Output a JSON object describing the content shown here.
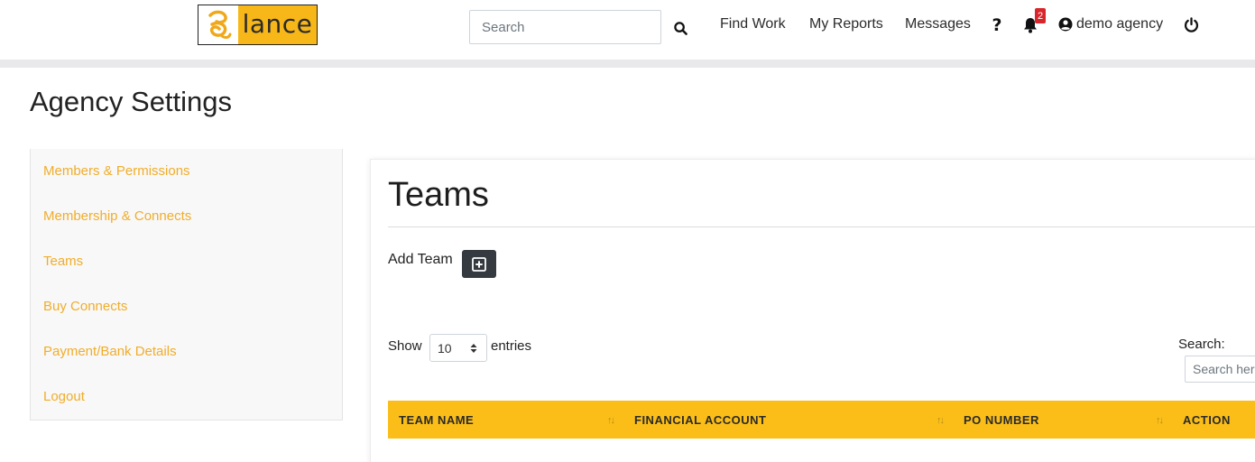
{
  "header": {
    "logo_text": "lance",
    "search": {
      "placeholder": "Search"
    },
    "nav": {
      "find_work": "Find Work",
      "my_reports": "My Reports",
      "messages": "Messages"
    },
    "help_glyph": "?",
    "notifications_count": "2",
    "user_name": "demo agency",
    "icons": [
      "search-icon",
      "question-icon",
      "bell-icon",
      "user-circle-icon",
      "power-icon"
    ]
  },
  "page": {
    "title": "Agency Settings"
  },
  "sidebar": {
    "items": [
      {
        "label": "Members & Permissions"
      },
      {
        "label": "Membership & Connects"
      },
      {
        "label": "Teams"
      },
      {
        "label": "Buy Connects"
      },
      {
        "label": "Payment/Bank Details"
      },
      {
        "label": "Logout"
      }
    ]
  },
  "main": {
    "title": "Teams",
    "add_team_label": "Add Team",
    "table": {
      "show_label": "Show",
      "entries_value": "10",
      "entries_label": "entries",
      "search_label": "Search:",
      "search_placeholder": "Search here",
      "columns": [
        {
          "label": "TEAM NAME"
        },
        {
          "label": "FINANCIAL ACCOUNT"
        },
        {
          "label": "PO NUMBER"
        },
        {
          "label": "ACTION"
        }
      ],
      "sort_glyph": "↑↓"
    }
  },
  "colors": {
    "accent": "#fbbe18",
    "sidebar_link": "#f0ad2b",
    "badge": "#d7262c",
    "button_dark": "#343a40"
  }
}
